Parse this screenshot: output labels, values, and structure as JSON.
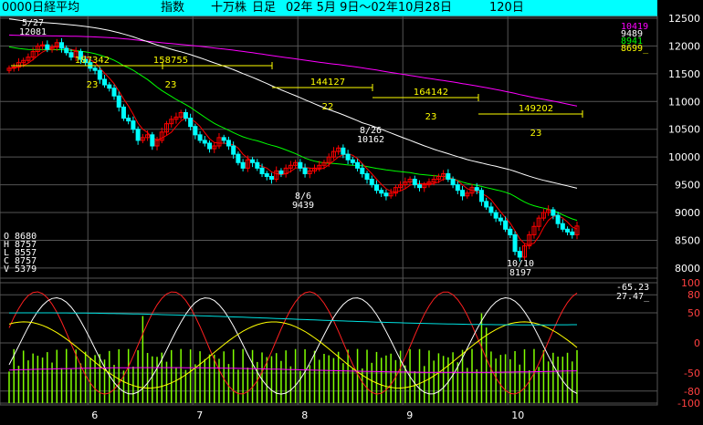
{
  "title": {
    "code": "0000日経平均",
    "kind": "指数",
    "unit": "十万株",
    "period": "日足",
    "range": "02年 5月 9日〜02年10月28日",
    "count": "120日"
  },
  "price_axis": {
    "labels": [
      "12500",
      "12000",
      "11500",
      "11000",
      "10500",
      "10000",
      "9500",
      "9000",
      "8500",
      "8000"
    ],
    "min": 7900,
    "max": 12500
  },
  "osc_axis": {
    "labels": [
      "100",
      "80",
      "50",
      "0",
      "-50",
      "-80",
      "-100"
    ]
  },
  "month_labels": [
    "6",
    "7",
    "8",
    "9",
    "10"
  ],
  "ma_legend": {
    "values": [
      "10419",
      "9489",
      "8941",
      "8699"
    ],
    "colors": [
      "#ff00ff",
      "#ffffff",
      "#00ff00",
      "#ffff00"
    ],
    "cursor": "_"
  },
  "osc_legend": {
    "values": [
      "-65.23",
      "27.47"
    ],
    "cursor": "_"
  },
  "ohlcv": {
    "labels": [
      "O",
      "H",
      "L",
      "C",
      "V"
    ],
    "values": [
      "8680",
      "8757",
      "8557",
      "8757",
      "5379"
    ]
  },
  "volume_blocks": [
    {
      "total": "187342",
      "days": "23"
    },
    {
      "total": "158755",
      "days": "23"
    },
    {
      "total": "144127",
      "days": "22"
    },
    {
      "total": "164142",
      "days": "23"
    },
    {
      "total": "149202",
      "days": "23"
    }
  ],
  "annotations": [
    {
      "date": "5/27",
      "price": "12081"
    },
    {
      "date": "8/6",
      "price": "9439"
    },
    {
      "date": "8/26",
      "price": "10162"
    },
    {
      "date": "10/10",
      "price": "8197"
    }
  ],
  "colors": {
    "up_candle": "#ff0000",
    "down_candle": "#00ffff",
    "ma5": "#ff0000",
    "ma25": "#00ff00",
    "ma75": "#ffffff",
    "ma200": "#ff00ff",
    "volume": "#80ff00",
    "grid": "#555555",
    "title_bg": "#00ffff"
  },
  "chart_data": {
    "type": "candlestick",
    "x_months": [
      "6",
      "7",
      "8",
      "9",
      "10"
    ],
    "closes": [
      11600,
      11620,
      11700,
      11740,
      11800,
      11900,
      12000,
      12020,
      11940,
      11980,
      12060,
      11960,
      11880,
      11800,
      11900,
      11760,
      11700,
      11600,
      11560,
      11400,
      11300,
      11240,
      11100,
      10900,
      10700,
      10650,
      10500,
      10300,
      10350,
      10400,
      10200,
      10300,
      10450,
      10600,
      10680,
      10720,
      10800,
      10700,
      10550,
      10400,
      10300,
      10250,
      10150,
      10200,
      10350,
      10300,
      10200,
      10050,
      9900,
      9800,
      9950,
      9900,
      9800,
      9700,
      9650,
      9600,
      9750,
      9700,
      9800,
      9850,
      9900,
      9800,
      9700,
      9750,
      9800,
      9850,
      9900,
      10000,
      10100,
      10162,
      10050,
      9950,
      9900,
      9800,
      9700,
      9600,
      9500,
      9400,
      9350,
      9300,
      9350,
      9450,
      9500,
      9550,
      9600,
      9500,
      9450,
      9500,
      9550,
      9600,
      9650,
      9700,
      9600,
      9500,
      9400,
      9300,
      9350,
      9450,
      9400,
      9200,
      9100,
      9000,
      8900,
      8850,
      8700,
      8600,
      8300,
      8197,
      8400,
      8600,
      8750,
      8900,
      9000,
      9050,
      8950,
      8800,
      8700,
      8650,
      8600,
      8757
    ]
  }
}
